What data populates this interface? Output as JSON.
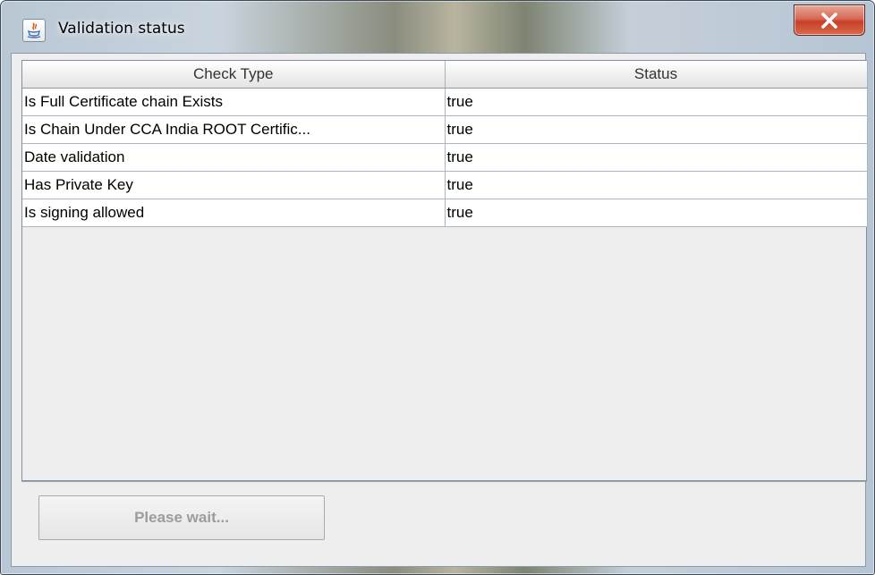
{
  "window": {
    "title": "Validation status",
    "app_icon": "java-icon",
    "close_icon": "close-icon",
    "close_label": "X"
  },
  "table": {
    "headers": [
      "Check Type",
      "Status"
    ],
    "rows": [
      {
        "check": "Is Full Certificate chain Exists",
        "status": "true"
      },
      {
        "check": "Is Chain Under CCA India ROOT Certific...",
        "status": "true"
      },
      {
        "check": "Date validation",
        "status": "true"
      },
      {
        "check": "Has Private Key",
        "status": "true"
      },
      {
        "check": "Is signing allowed",
        "status": "true"
      }
    ]
  },
  "button": {
    "label": "Please wait..."
  },
  "colors": {
    "close_button": "#c7402a",
    "table_grid": "#aab6c4",
    "disabled_text": "#9c9c9c"
  }
}
